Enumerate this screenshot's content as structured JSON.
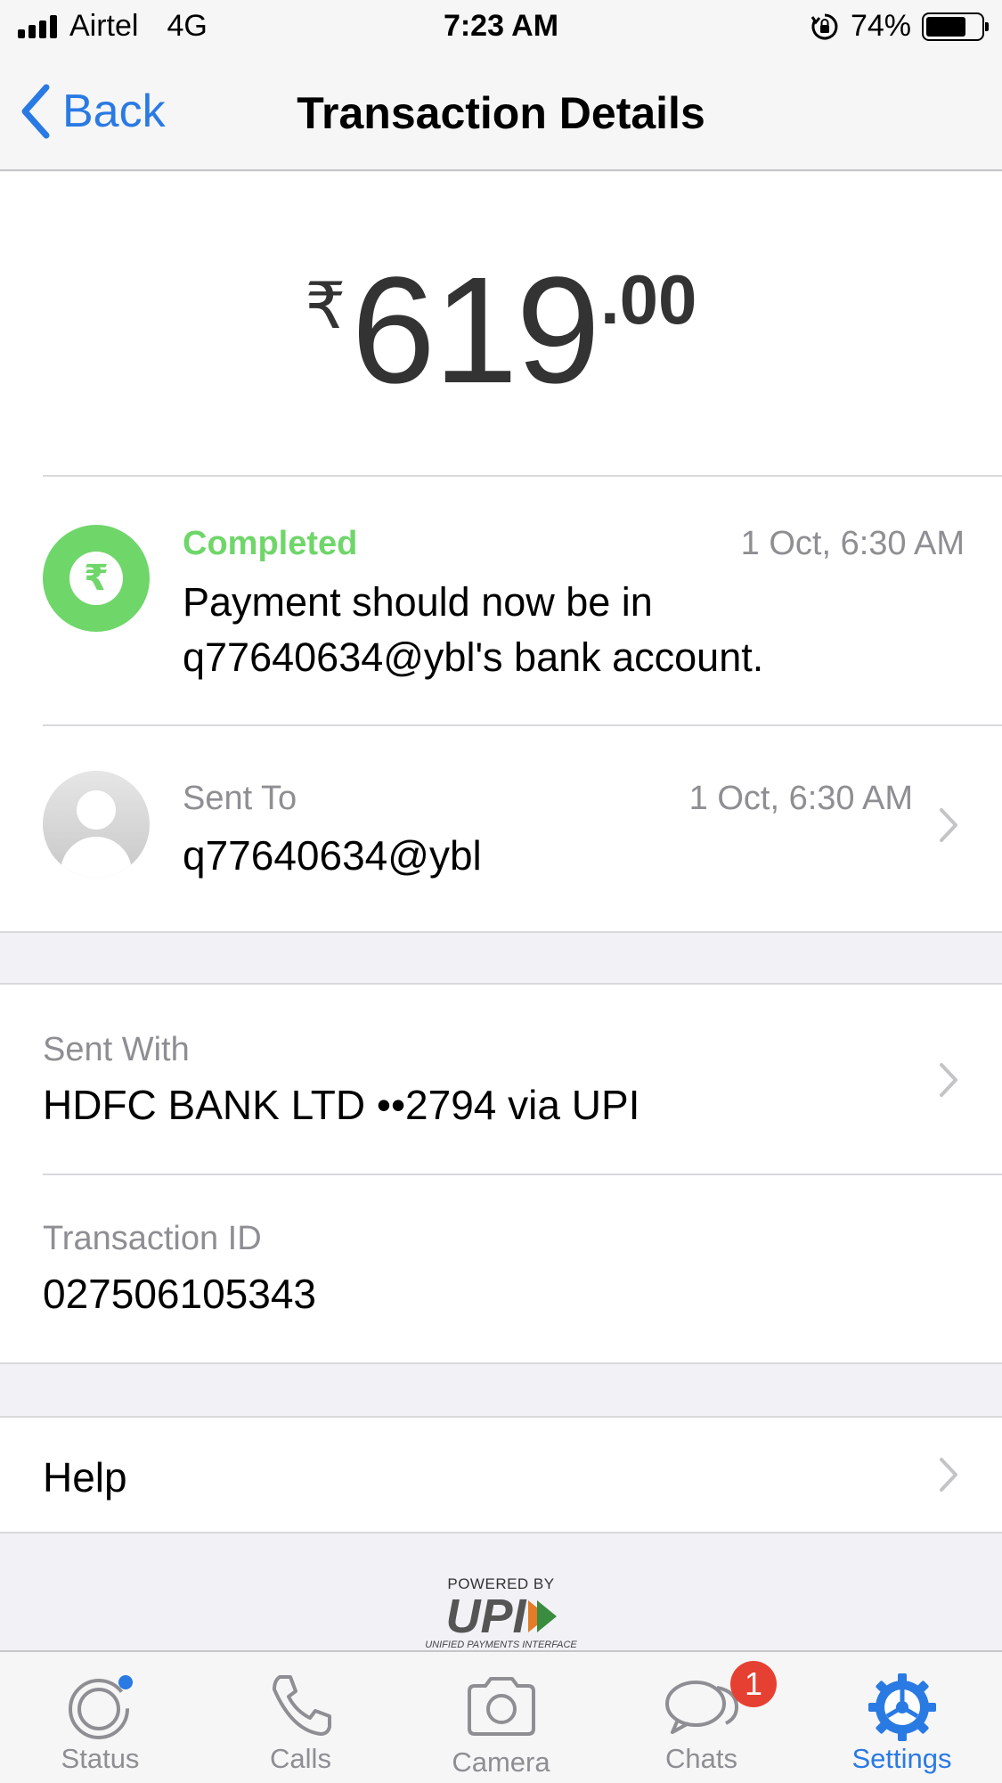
{
  "status_bar": {
    "carrier": "Airtel",
    "network": "4G",
    "time": "7:23 AM",
    "battery": "74%",
    "battery_level": 0.74,
    "rotation_lock_icon": "rotation-lock-icon"
  },
  "nav": {
    "back_label": "Back",
    "title": "Transaction Details"
  },
  "amount": {
    "currency_symbol": "₹",
    "main": "619",
    "decimal": ".00"
  },
  "status": {
    "label": "Completed",
    "date": "1 Oct, 6:30 AM",
    "message": "Payment should now be in q77640634@ybl's bank account.",
    "icon_glyph": "₹"
  },
  "sent_to": {
    "label": "Sent To",
    "date": "1 Oct, 6:30 AM",
    "value": "q77640634@ybl"
  },
  "sent_with": {
    "label": "Sent With",
    "value": "HDFC BANK LTD ••2794 via UPI"
  },
  "transaction": {
    "label": "Transaction ID",
    "value": "027506105343"
  },
  "help": {
    "label": "Help"
  },
  "powered_by": {
    "top": "POWERED BY",
    "logo": "UPI",
    "sub": "UNIFIED PAYMENTS INTERFACE"
  },
  "tabs": [
    {
      "label": "Status",
      "icon": "status-icon"
    },
    {
      "label": "Calls",
      "icon": "phone-icon"
    },
    {
      "label": "Camera",
      "icon": "camera-icon"
    },
    {
      "label": "Chats",
      "icon": "chats-icon",
      "badge": "1"
    },
    {
      "label": "Settings",
      "icon": "settings-icon",
      "active": true
    }
  ],
  "colors": {
    "accent": "#2a7ae4",
    "success": "#6fd66a",
    "badge": "#e64033"
  }
}
